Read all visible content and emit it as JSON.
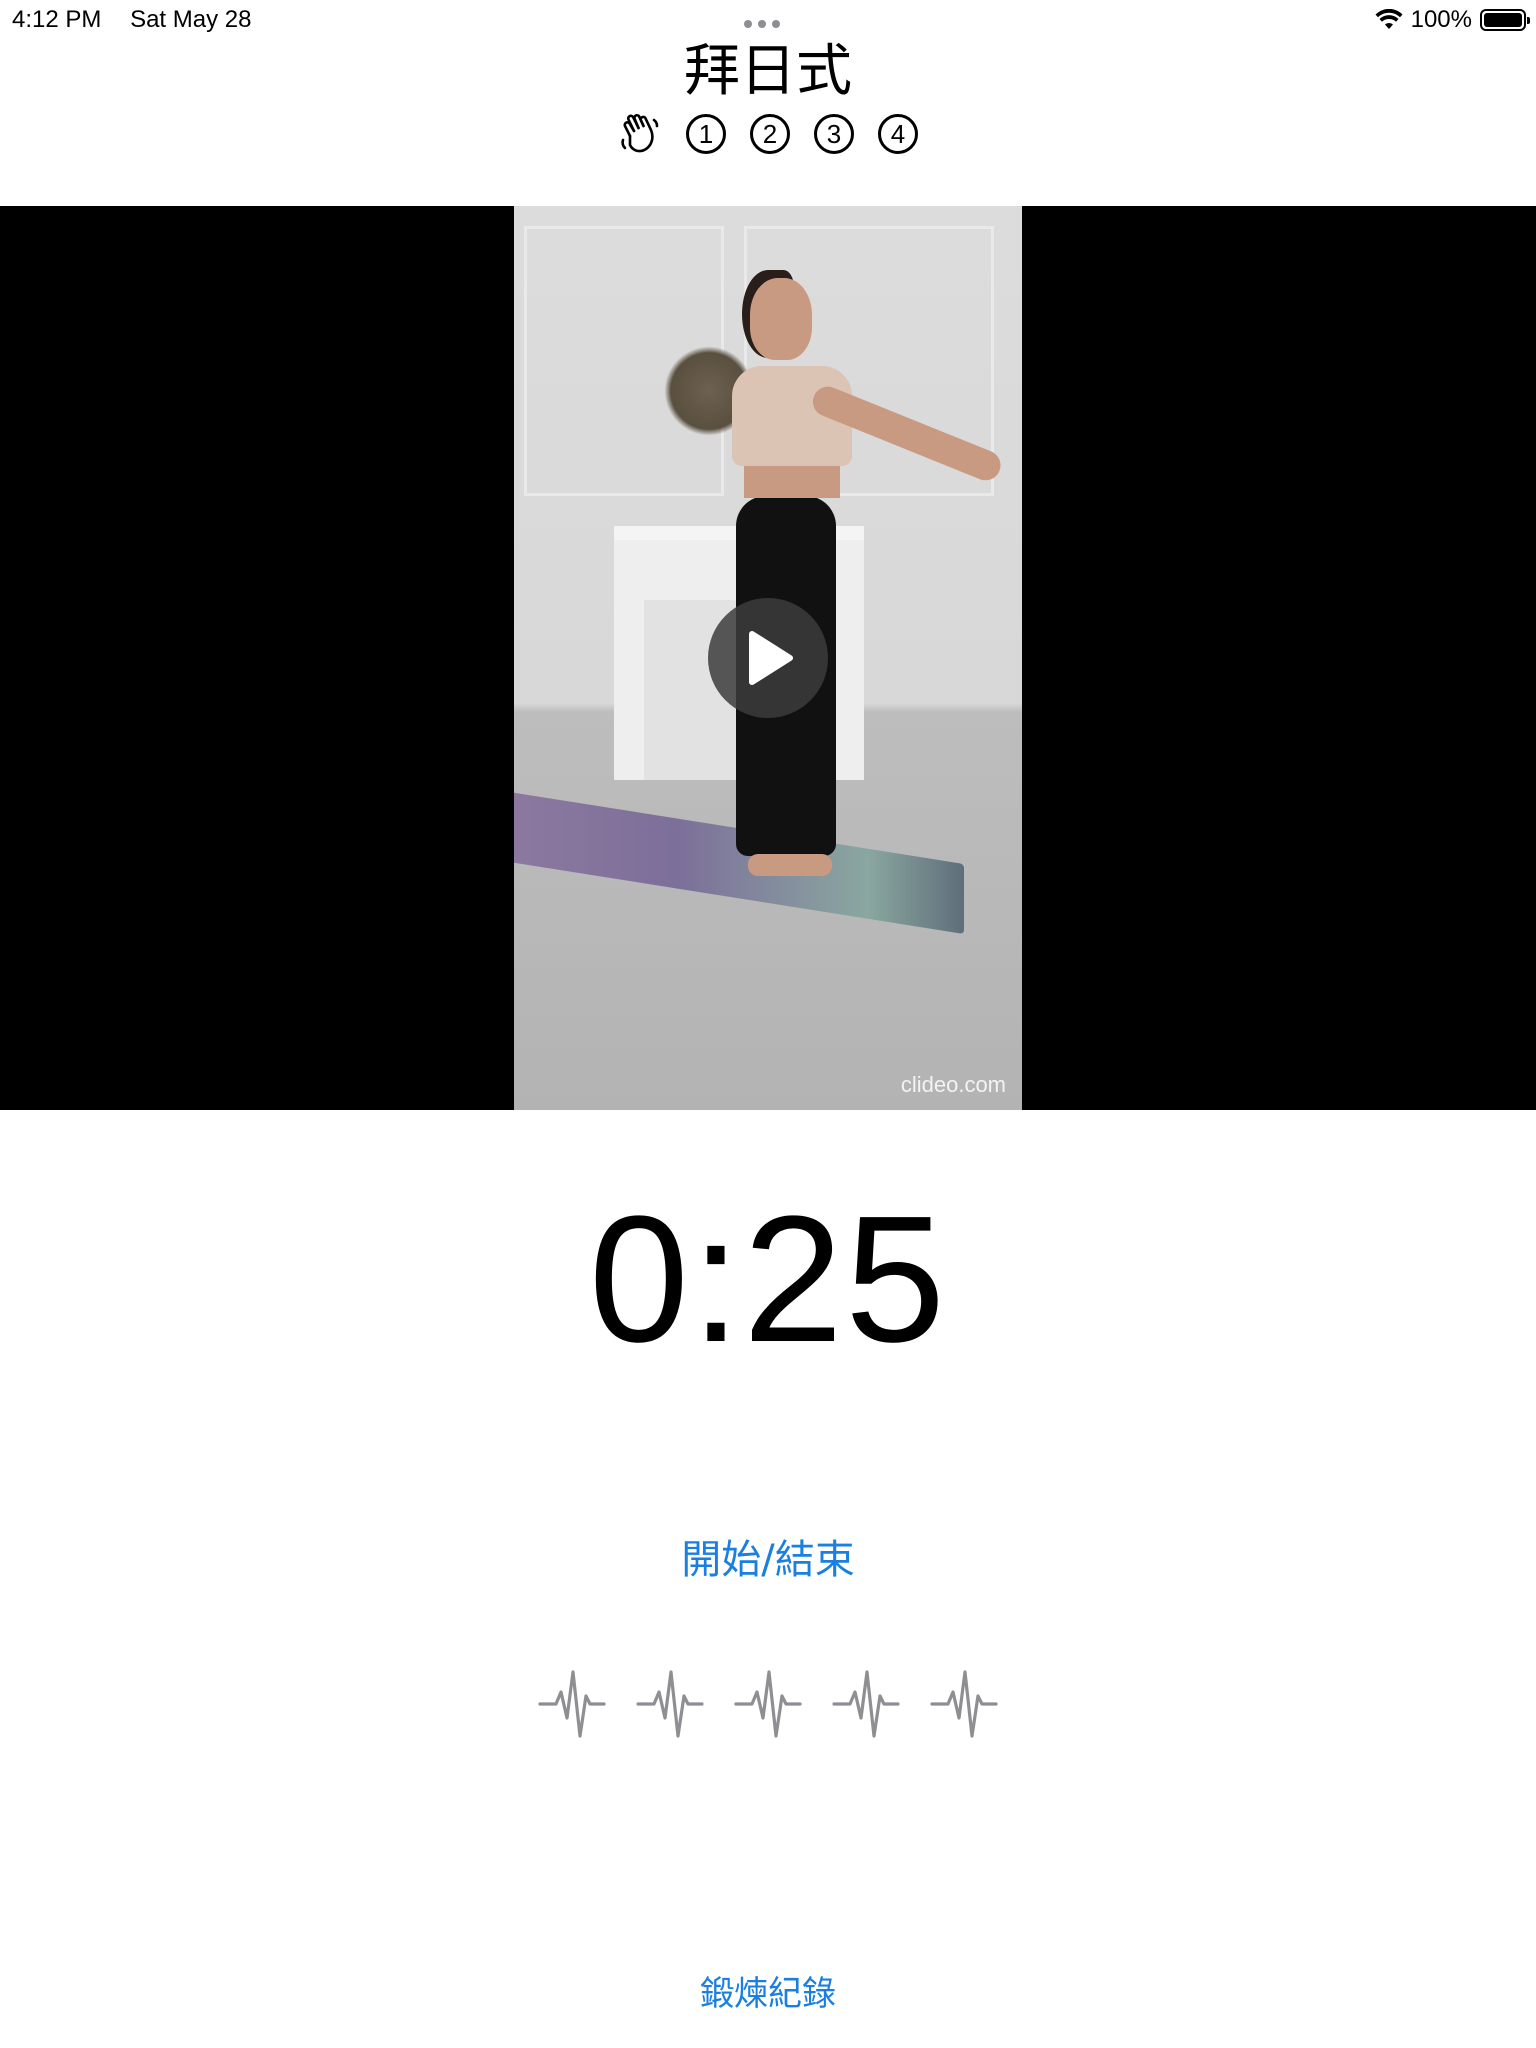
{
  "status_bar": {
    "time": "4:12 PM",
    "date": "Sat May 28",
    "battery": "100%",
    "icons": [
      "wifi-icon",
      "battery-icon"
    ]
  },
  "header": {
    "title": "拜日式",
    "steps": [
      {
        "icon": "waving-hand-icon"
      },
      {
        "label": "1"
      },
      {
        "label": "2"
      },
      {
        "label": "3"
      },
      {
        "label": "4"
      }
    ]
  },
  "video": {
    "watermark": "clideo.com",
    "play_icon": "play-icon"
  },
  "timer": {
    "value": "0:25"
  },
  "controls": {
    "start_stop_label": "開始/結束",
    "heartbeat_count": 5,
    "heartbeat_icon": "waveform-path-ecg-icon",
    "heartbeat_color": "#8e8e93",
    "accent_color": "#1a7fe0"
  },
  "footer": {
    "history_label": "鍛煉紀錄"
  }
}
